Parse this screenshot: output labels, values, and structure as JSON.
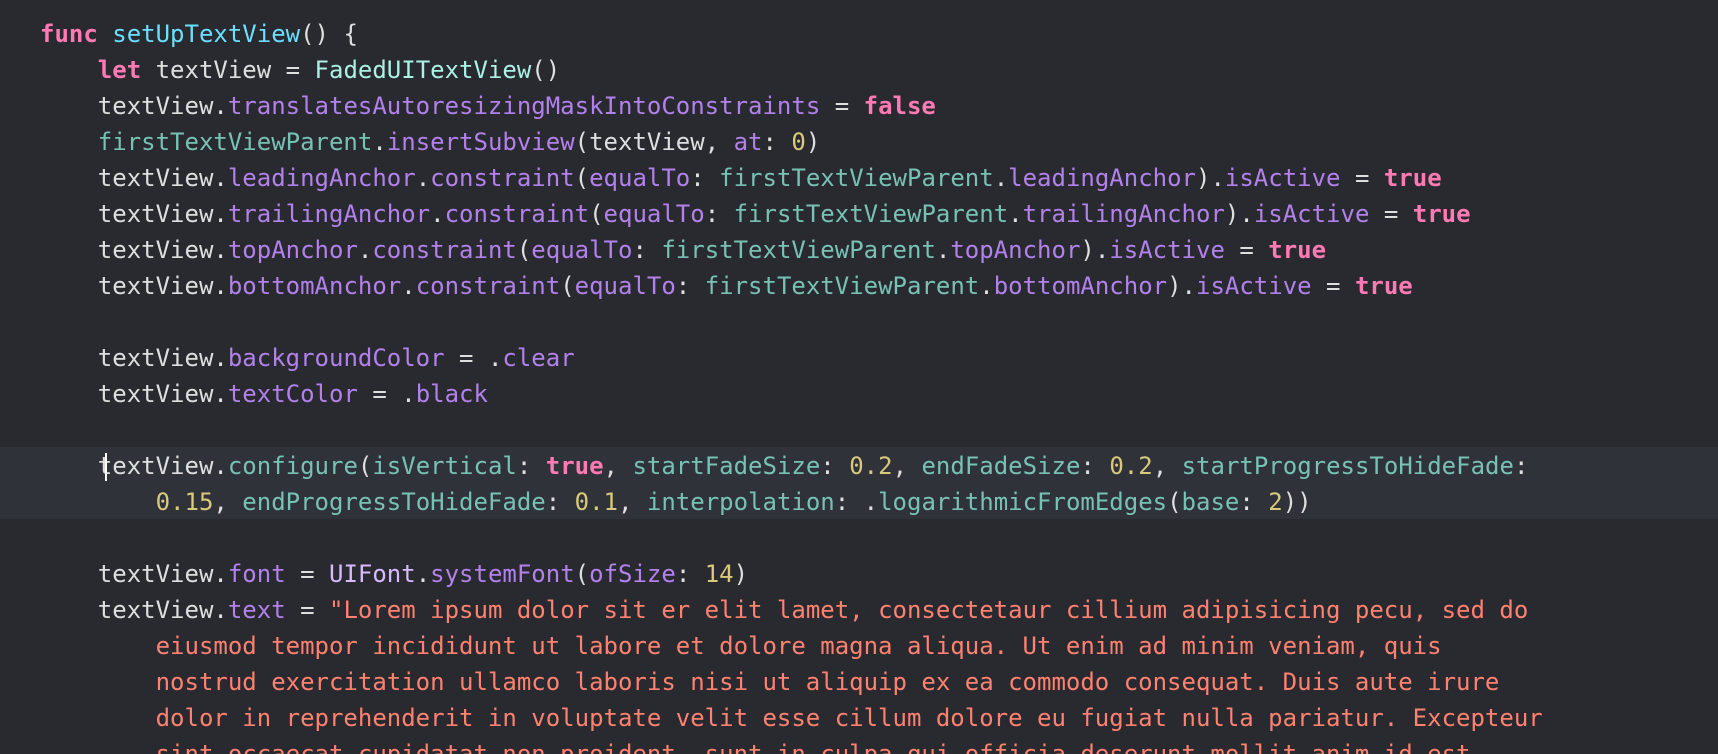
{
  "editor": {
    "colors": {
      "background": "#292a30",
      "current_line": "#2f3239",
      "keyword": "#ff7ab2",
      "function_decl": "#6bdfff",
      "project_type": "#acf2e4",
      "project_member": "#78c2b3",
      "system_member": "#b281eb",
      "number": "#d9c97c",
      "string": "#ff8170",
      "plain": "#dfdfe0"
    },
    "lines": [
      [
        {
          "t": "func",
          "c": "kw"
        },
        {
          "t": " ",
          "c": "pl"
        },
        {
          "t": "setUpTextView",
          "c": "fn"
        },
        {
          "t": "() {",
          "c": "pl"
        }
      ],
      [
        {
          "t": "    ",
          "c": "pl"
        },
        {
          "t": "let",
          "c": "kw"
        },
        {
          "t": " textView = ",
          "c": "pl"
        },
        {
          "t": "FadedUITextView",
          "c": "pt"
        },
        {
          "t": "()",
          "c": "pl"
        }
      ],
      [
        {
          "t": "    textView.",
          "c": "pl"
        },
        {
          "t": "translatesAutoresizingMaskIntoConstraints",
          "c": "pr"
        },
        {
          "t": " = ",
          "c": "pl"
        },
        {
          "t": "false",
          "c": "kw"
        }
      ],
      [
        {
          "t": "    ",
          "c": "pl"
        },
        {
          "t": "firstTextViewParent",
          "c": "pj"
        },
        {
          "t": ".",
          "c": "pl"
        },
        {
          "t": "insertSubview",
          "c": "pr"
        },
        {
          "t": "(textView, ",
          "c": "pl"
        },
        {
          "t": "at",
          "c": "pr"
        },
        {
          "t": ": ",
          "c": "pl"
        },
        {
          "t": "0",
          "c": "nm"
        },
        {
          "t": ")",
          "c": "pl"
        }
      ],
      [
        {
          "t": "    textView.",
          "c": "pl"
        },
        {
          "t": "leadingAnchor",
          "c": "pr"
        },
        {
          "t": ".",
          "c": "pl"
        },
        {
          "t": "constraint",
          "c": "pr"
        },
        {
          "t": "(",
          "c": "pl"
        },
        {
          "t": "equalTo",
          "c": "pr"
        },
        {
          "t": ": ",
          "c": "pl"
        },
        {
          "t": "firstTextViewParent",
          "c": "pj"
        },
        {
          "t": ".",
          "c": "pl"
        },
        {
          "t": "leadingAnchor",
          "c": "pr"
        },
        {
          "t": ").",
          "c": "pl"
        },
        {
          "t": "isActive",
          "c": "pr"
        },
        {
          "t": " = ",
          "c": "pl"
        },
        {
          "t": "true",
          "c": "kw"
        }
      ],
      [
        {
          "t": "    textView.",
          "c": "pl"
        },
        {
          "t": "trailingAnchor",
          "c": "pr"
        },
        {
          "t": ".",
          "c": "pl"
        },
        {
          "t": "constraint",
          "c": "pr"
        },
        {
          "t": "(",
          "c": "pl"
        },
        {
          "t": "equalTo",
          "c": "pr"
        },
        {
          "t": ": ",
          "c": "pl"
        },
        {
          "t": "firstTextViewParent",
          "c": "pj"
        },
        {
          "t": ".",
          "c": "pl"
        },
        {
          "t": "trailingAnchor",
          "c": "pr"
        },
        {
          "t": ").",
          "c": "pl"
        },
        {
          "t": "isActive",
          "c": "pr"
        },
        {
          "t": " = ",
          "c": "pl"
        },
        {
          "t": "true",
          "c": "kw"
        }
      ],
      [
        {
          "t": "    textView.",
          "c": "pl"
        },
        {
          "t": "topAnchor",
          "c": "pr"
        },
        {
          "t": ".",
          "c": "pl"
        },
        {
          "t": "constraint",
          "c": "pr"
        },
        {
          "t": "(",
          "c": "pl"
        },
        {
          "t": "equalTo",
          "c": "pr"
        },
        {
          "t": ": ",
          "c": "pl"
        },
        {
          "t": "firstTextViewParent",
          "c": "pj"
        },
        {
          "t": ".",
          "c": "pl"
        },
        {
          "t": "topAnchor",
          "c": "pr"
        },
        {
          "t": ").",
          "c": "pl"
        },
        {
          "t": "isActive",
          "c": "pr"
        },
        {
          "t": " = ",
          "c": "pl"
        },
        {
          "t": "true",
          "c": "kw"
        }
      ],
      [
        {
          "t": "    textView.",
          "c": "pl"
        },
        {
          "t": "bottomAnchor",
          "c": "pr"
        },
        {
          "t": ".",
          "c": "pl"
        },
        {
          "t": "constraint",
          "c": "pr"
        },
        {
          "t": "(",
          "c": "pl"
        },
        {
          "t": "equalTo",
          "c": "pr"
        },
        {
          "t": ": ",
          "c": "pl"
        },
        {
          "t": "firstTextViewParent",
          "c": "pj"
        },
        {
          "t": ".",
          "c": "pl"
        },
        {
          "t": "bottomAnchor",
          "c": "pr"
        },
        {
          "t": ").",
          "c": "pl"
        },
        {
          "t": "isActive",
          "c": "pr"
        },
        {
          "t": " = ",
          "c": "pl"
        },
        {
          "t": "true",
          "c": "kw"
        }
      ],
      [],
      [
        {
          "t": "    textView.",
          "c": "pl"
        },
        {
          "t": "backgroundColor",
          "c": "pr"
        },
        {
          "t": " = .",
          "c": "pl"
        },
        {
          "t": "clear",
          "c": "pr"
        }
      ],
      [
        {
          "t": "    textView.",
          "c": "pl"
        },
        {
          "t": "textColor",
          "c": "pr"
        },
        {
          "t": " = .",
          "c": "pl"
        },
        {
          "t": "black",
          "c": "pr"
        }
      ],
      [],
      [
        {
          "t": "    textView.",
          "c": "pl"
        },
        {
          "t": "configure",
          "c": "pj"
        },
        {
          "t": "(",
          "c": "pl"
        },
        {
          "t": "isVertical",
          "c": "pj"
        },
        {
          "t": ": ",
          "c": "pl"
        },
        {
          "t": "true",
          "c": "kw"
        },
        {
          "t": ", ",
          "c": "pl"
        },
        {
          "t": "startFadeSize",
          "c": "pj"
        },
        {
          "t": ": ",
          "c": "pl"
        },
        {
          "t": "0.2",
          "c": "nm"
        },
        {
          "t": ", ",
          "c": "pl"
        },
        {
          "t": "endFadeSize",
          "c": "pj"
        },
        {
          "t": ": ",
          "c": "pl"
        },
        {
          "t": "0.2",
          "c": "nm"
        },
        {
          "t": ", ",
          "c": "pl"
        },
        {
          "t": "startProgressToHideFade",
          "c": "pj"
        },
        {
          "t": ":",
          "c": "pl"
        }
      ],
      [
        {
          "t": "        ",
          "c": "pl"
        },
        {
          "t": "0.15",
          "c": "nm"
        },
        {
          "t": ", ",
          "c": "pl"
        },
        {
          "t": "endProgressToHideFade",
          "c": "pj"
        },
        {
          "t": ": ",
          "c": "pl"
        },
        {
          "t": "0.1",
          "c": "nm"
        },
        {
          "t": ", ",
          "c": "pl"
        },
        {
          "t": "interpolation",
          "c": "pj"
        },
        {
          "t": ": .",
          "c": "pl"
        },
        {
          "t": "logarithmicFromEdges",
          "c": "pj"
        },
        {
          "t": "(",
          "c": "pl"
        },
        {
          "t": "base",
          "c": "pj"
        },
        {
          "t": ": ",
          "c": "pl"
        },
        {
          "t": "2",
          "c": "nm"
        },
        {
          "t": "))",
          "c": "pl"
        }
      ],
      [],
      [
        {
          "t": "    textView.",
          "c": "pl"
        },
        {
          "t": "font",
          "c": "pr"
        },
        {
          "t": " = ",
          "c": "pl"
        },
        {
          "t": "UIFont",
          "c": "ty"
        },
        {
          "t": ".",
          "c": "pl"
        },
        {
          "t": "systemFont",
          "c": "pr"
        },
        {
          "t": "(",
          "c": "pl"
        },
        {
          "t": "ofSize",
          "c": "pr"
        },
        {
          "t": ": ",
          "c": "pl"
        },
        {
          "t": "14",
          "c": "nm"
        },
        {
          "t": ")",
          "c": "pl"
        }
      ],
      [
        {
          "t": "    textView.",
          "c": "pl"
        },
        {
          "t": "text",
          "c": "pr"
        },
        {
          "t": " = ",
          "c": "pl"
        },
        {
          "t": "\"Lorem ipsum dolor sit er elit lamet, consectetaur cillium adipisicing pecu, sed do",
          "c": "st"
        }
      ],
      [
        {
          "t": "        ",
          "c": "pl"
        },
        {
          "t": "eiusmod tempor incididunt ut labore et dolore magna aliqua. Ut enim ad minim veniam, quis",
          "c": "st"
        }
      ],
      [
        {
          "t": "        ",
          "c": "pl"
        },
        {
          "t": "nostrud exercitation ullamco laboris nisi ut aliquip ex ea commodo consequat. Duis aute irure",
          "c": "st"
        }
      ],
      [
        {
          "t": "        ",
          "c": "pl"
        },
        {
          "t": "dolor in reprehenderit in voluptate velit esse cillum dolore eu fugiat nulla pariatur. Excepteur",
          "c": "st"
        }
      ],
      [
        {
          "t": "        ",
          "c": "pl"
        },
        {
          "t": "sint occaecat cupidatat non proident, sunt in culpa qui officia deserunt mollit anim id est",
          "c": "st"
        }
      ]
    ]
  }
}
